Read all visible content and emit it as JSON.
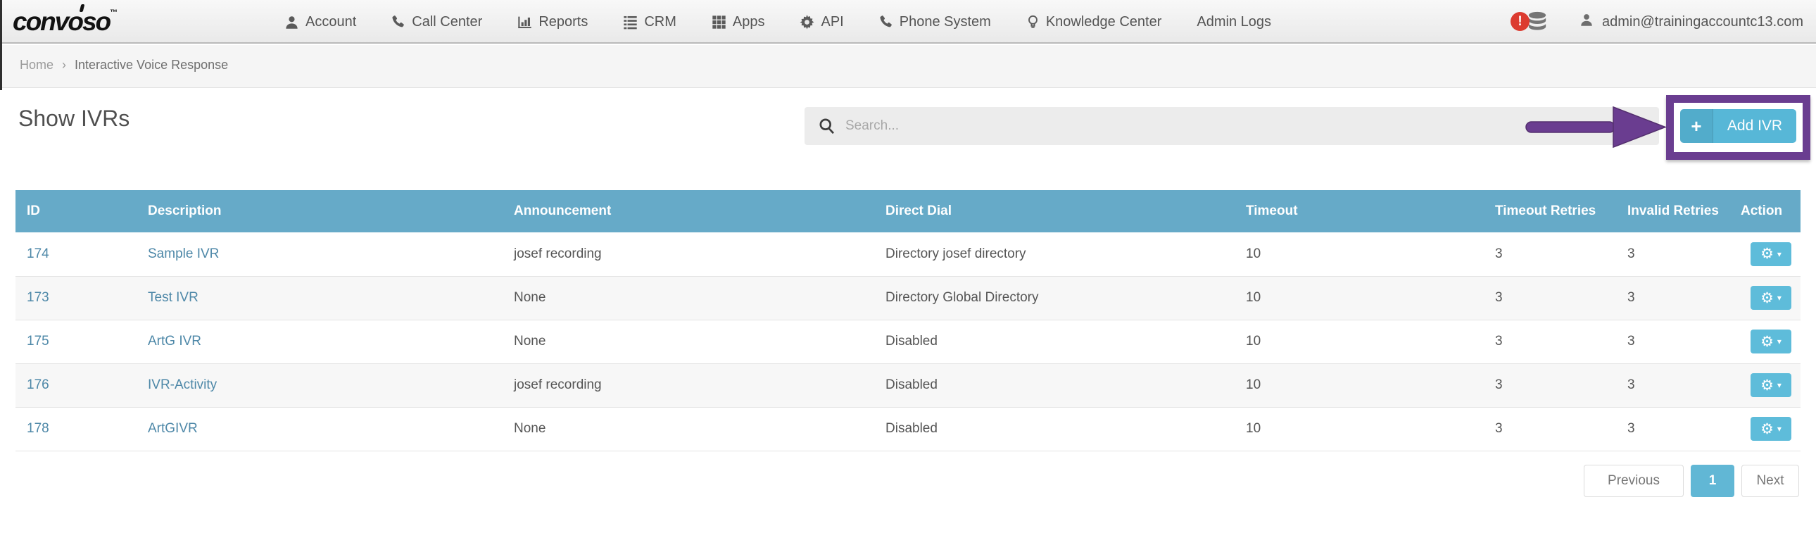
{
  "navbar": {
    "logo": "convoso",
    "logo_tm": "™",
    "items": [
      {
        "label": "Account",
        "icon": "user-icon"
      },
      {
        "label": "Call Center",
        "icon": "phone-icon"
      },
      {
        "label": "Reports",
        "icon": "bar-chart-icon"
      },
      {
        "label": "CRM",
        "icon": "list-icon"
      },
      {
        "label": "Apps",
        "icon": "grid-icon"
      },
      {
        "label": "API",
        "icon": "gear-icon"
      },
      {
        "label": "Phone System",
        "icon": "phone-icon"
      },
      {
        "label": "Knowledge Center",
        "icon": "lightbulb-icon"
      },
      {
        "label": "Admin Logs",
        "icon": null
      }
    ],
    "alert_badge": "!",
    "user_email": "admin@trainingaccountc13.com"
  },
  "breadcrumb": {
    "home": "Home",
    "separator": "›",
    "current": "Interactive Voice Response"
  },
  "page": {
    "title": "Show IVRs"
  },
  "search": {
    "placeholder": "Search...",
    "value": ""
  },
  "add_button": {
    "plus": "+",
    "label": "Add IVR"
  },
  "table": {
    "headers": [
      "ID",
      "Description",
      "Announcement",
      "Direct Dial",
      "Timeout",
      "Timeout Retries",
      "Invalid Retries",
      "Action"
    ],
    "rows": [
      {
        "id": "174",
        "description": "Sample IVR",
        "announcement": "josef recording",
        "direct_dial": "Directory josef directory",
        "timeout": "10",
        "timeout_retries": "3",
        "invalid_retries": "3"
      },
      {
        "id": "173",
        "description": "Test IVR",
        "announcement": "None",
        "direct_dial": "Directory Global Directory",
        "timeout": "10",
        "timeout_retries": "3",
        "invalid_retries": "3"
      },
      {
        "id": "175",
        "description": "ArtG IVR",
        "announcement": "None",
        "direct_dial": "Disabled",
        "timeout": "10",
        "timeout_retries": "3",
        "invalid_retries": "3"
      },
      {
        "id": "176",
        "description": "IVR-Activity",
        "announcement": "josef recording",
        "direct_dial": "Disabled",
        "timeout": "10",
        "timeout_retries": "3",
        "invalid_retries": "3"
      },
      {
        "id": "178",
        "description": "ArtGIVR",
        "announcement": "None",
        "direct_dial": "Disabled",
        "timeout": "10",
        "timeout_retries": "3",
        "invalid_retries": "3"
      }
    ]
  },
  "pagination": {
    "previous": "Previous",
    "current_page": "1",
    "next": "Next"
  },
  "colors": {
    "table_header_blue": "#66aac8",
    "accent_blue": "#57b7d7",
    "annotation_purple": "#6a3d90",
    "alert_red": "#dc3b30",
    "link_blue": "#4e88a8"
  }
}
